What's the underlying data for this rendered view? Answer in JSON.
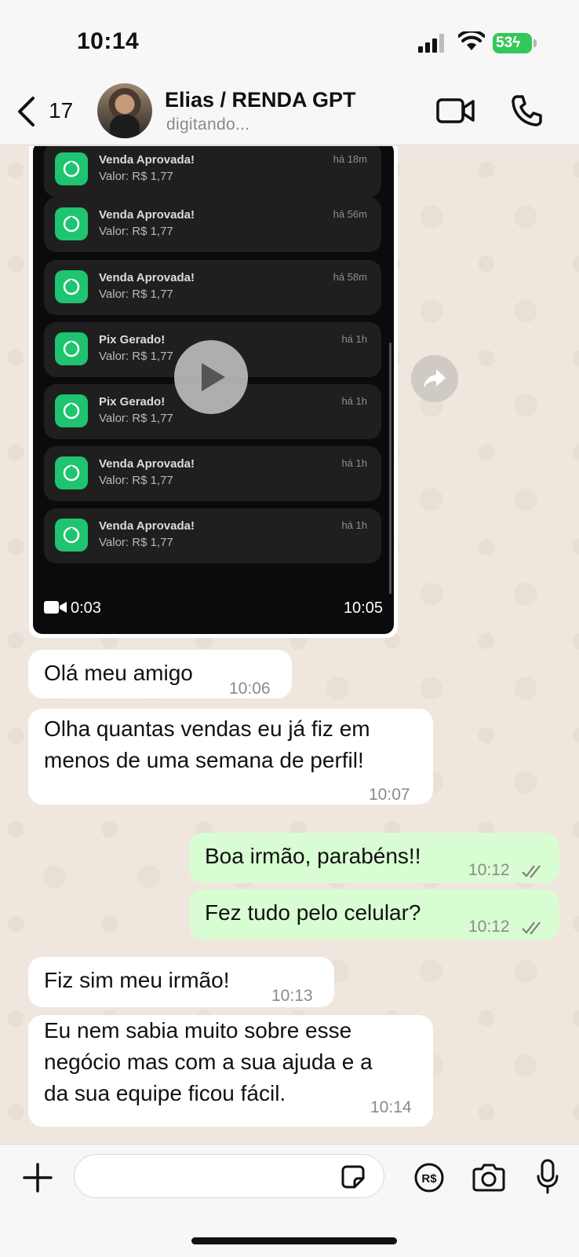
{
  "status_bar": {
    "time": "10:14",
    "battery": "53"
  },
  "header": {
    "back_count": "17",
    "contact_name": "Elias / RENDA GPT",
    "contact_status": "digitando..."
  },
  "video_message": {
    "notifications": [
      {
        "title": "Venda Aprovada!",
        "value": "Valor: R$ 1,77",
        "time": "há 18m"
      },
      {
        "title": "Venda Aprovada!",
        "value": "Valor: R$ 1,77",
        "time": "há 56m"
      },
      {
        "title": "Venda Aprovada!",
        "value": "Valor: R$ 1,77",
        "time": "há 58m"
      },
      {
        "title": "Pix Gerado!",
        "value": "Valor: R$ 1,77",
        "time": "há 1h"
      },
      {
        "title": "Pix Gerado!",
        "value": "Valor: R$ 1,77",
        "time": "há 1h"
      },
      {
        "title": "Venda Aprovada!",
        "value": "Valor: R$ 1,77",
        "time": "há 1h"
      },
      {
        "title": "Venda Aprovada!",
        "value": "Valor: R$ 1,77",
        "time": "há 1h"
      }
    ],
    "duration": "0:03",
    "timestamp": "10:05"
  },
  "messages": [
    {
      "direction": "in",
      "text": "Olá meu amigo",
      "time": "10:06"
    },
    {
      "direction": "in",
      "text_lines": [
        "Olha quantas vendas eu já fiz em",
        "menos de uma semana de perfil!"
      ],
      "time": "10:07"
    },
    {
      "direction": "out",
      "text": "Boa irmão, parabéns!!",
      "time": "10:12"
    },
    {
      "direction": "out",
      "text": "Fez tudo pelo celular?",
      "time": "10:12"
    },
    {
      "direction": "in",
      "text": "Fiz sim meu irmão!",
      "time": "10:13"
    },
    {
      "direction": "in",
      "text_lines": [
        "Eu nem sabia muito sobre esse",
        "negócio mas com a sua ajuda e a",
        "da sua equipe ficou fácil."
      ],
      "time": "10:14"
    }
  ],
  "composer": {
    "input_value": "",
    "payment_label": "R$"
  },
  "colors": {
    "incoming_bubble": "#ffffff",
    "outgoing_bubble": "#d9fdd3",
    "chat_background": "#efe7de",
    "notification_icon": "#1ec46f",
    "battery": "#34c759"
  }
}
